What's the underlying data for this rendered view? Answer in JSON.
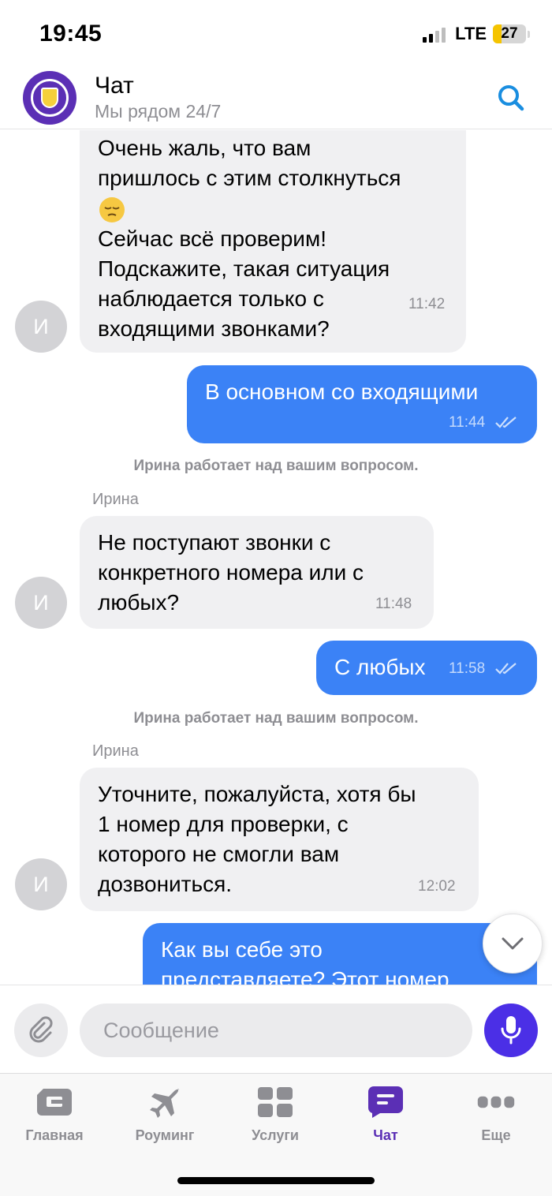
{
  "status_bar": {
    "time": "19:45",
    "network": "LTE",
    "battery": "27",
    "battery_level": 0.27
  },
  "header": {
    "title": "Чат",
    "subtitle": "Мы рядом 24/7"
  },
  "messages": [
    {
      "lines": [
        "Очень жаль, что вам",
        "пришлось с этим столкнуться"
      ],
      "emoji": "pensive-face",
      "lines2": [
        "Сейчас всё проверим!",
        "Подскажите, такая ситуация",
        "наблюдается только с",
        "входящими звонками?"
      ],
      "time": "11:42",
      "avatar": "И"
    },
    {
      "text": "В основном со входящими",
      "time": "11:44"
    },
    {
      "system": "Ирина работает над вашим вопросом."
    },
    {
      "sender": "Ирина",
      "lines": [
        "Не поступают звонки с",
        "конкретного номера или с",
        "любых?"
      ],
      "time": "11:48",
      "avatar": "И"
    },
    {
      "text": "С любых",
      "time": "11:58"
    },
    {
      "system": "Ирина работает над вашим вопросом."
    },
    {
      "sender": "Ирина",
      "lines": [
        "Уточните, пожалуйста, хотя бы",
        "1 номер для проверки, с",
        "которого не смогли вам",
        "дозвониться."
      ],
      "time": "12:02",
      "avatar": "И"
    },
    {
      "lines": [
        "Как вы себе это",
        "представляете? Этот номер"
      ]
    }
  ],
  "composer": {
    "placeholder": "Сообщение"
  },
  "tabs": [
    {
      "label": "Главная",
      "icon": "home-card-icon",
      "active": false
    },
    {
      "label": "Роуминг",
      "icon": "airplane-icon",
      "active": false
    },
    {
      "label": "Услуги",
      "icon": "grid-icon",
      "active": false
    },
    {
      "label": "Чат",
      "icon": "chat-icon",
      "active": true
    },
    {
      "label": "Еще",
      "icon": "more-icon",
      "active": false
    }
  ],
  "colors": {
    "brand": "#5b2fb5",
    "outgoing_bubble": "#3b82f6",
    "incoming_bubble": "#f0f0f2",
    "mic_button": "#4b2fe6",
    "search_icon": "#1a8ee0"
  }
}
